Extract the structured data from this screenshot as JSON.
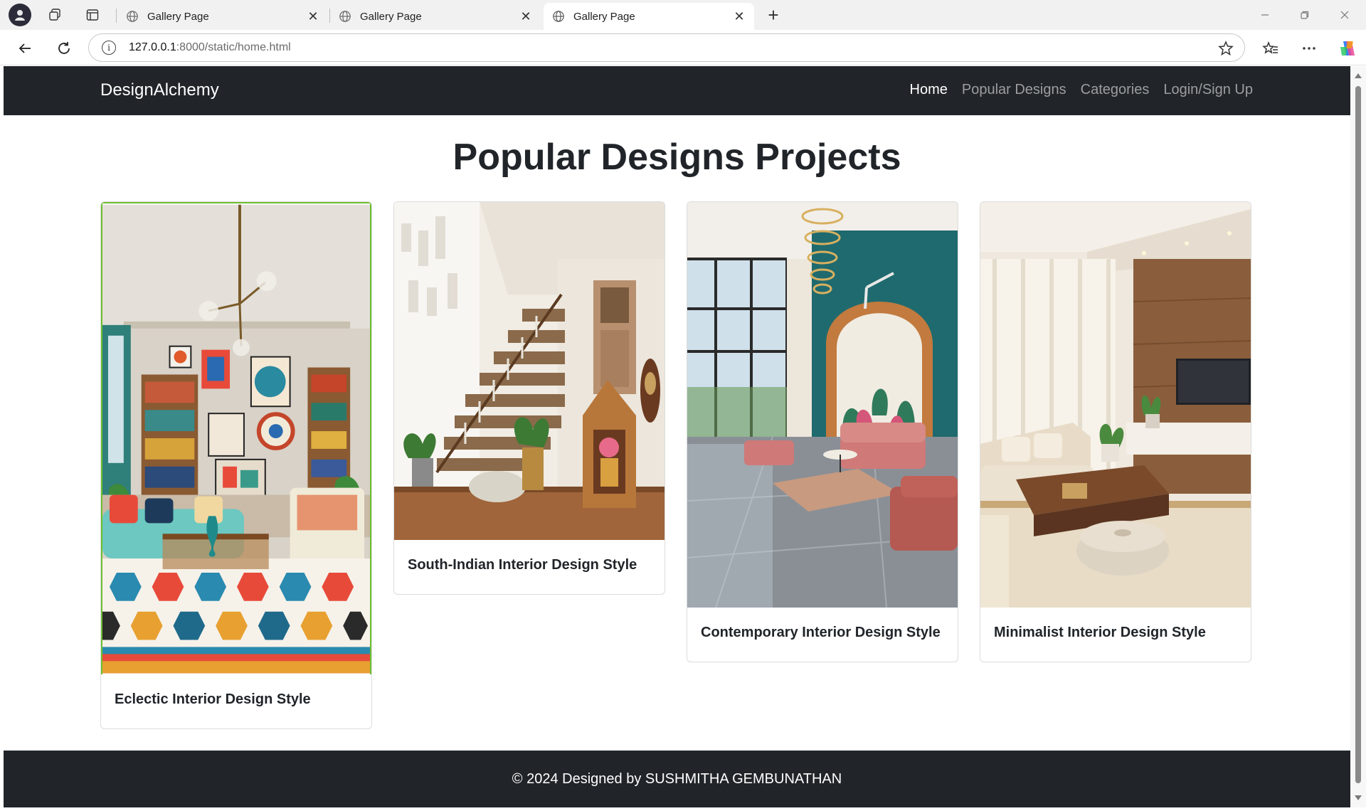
{
  "browser": {
    "tabs": [
      {
        "title": "Gallery Page",
        "active": false
      },
      {
        "title": "Gallery Page",
        "active": false
      },
      {
        "title": "Gallery Page",
        "active": true
      }
    ],
    "address": {
      "host": "127.0.0.1",
      "path": ":8000/static/home.html"
    }
  },
  "site": {
    "brand": "DesignAlchemy",
    "nav": [
      {
        "label": "Home",
        "active": true
      },
      {
        "label": "Popular Designs",
        "active": false
      },
      {
        "label": "Categories",
        "active": false
      },
      {
        "label": "Login/Sign Up",
        "active": false
      }
    ],
    "heading": "Popular Designs Projects",
    "cards": [
      {
        "title": "Eclectic Interior Design Style"
      },
      {
        "title": "South-Indian Interior Design Style"
      },
      {
        "title": "Contemporary Interior Design Style"
      },
      {
        "title": "Minimalist Interior Design Style"
      }
    ],
    "footer": "© 2024 Designed by SUSHMITHA GEMBUNATHAN"
  },
  "colors": {
    "navbar": "#212529",
    "text": "#212529",
    "active_card_border": "#6cbf2f"
  }
}
